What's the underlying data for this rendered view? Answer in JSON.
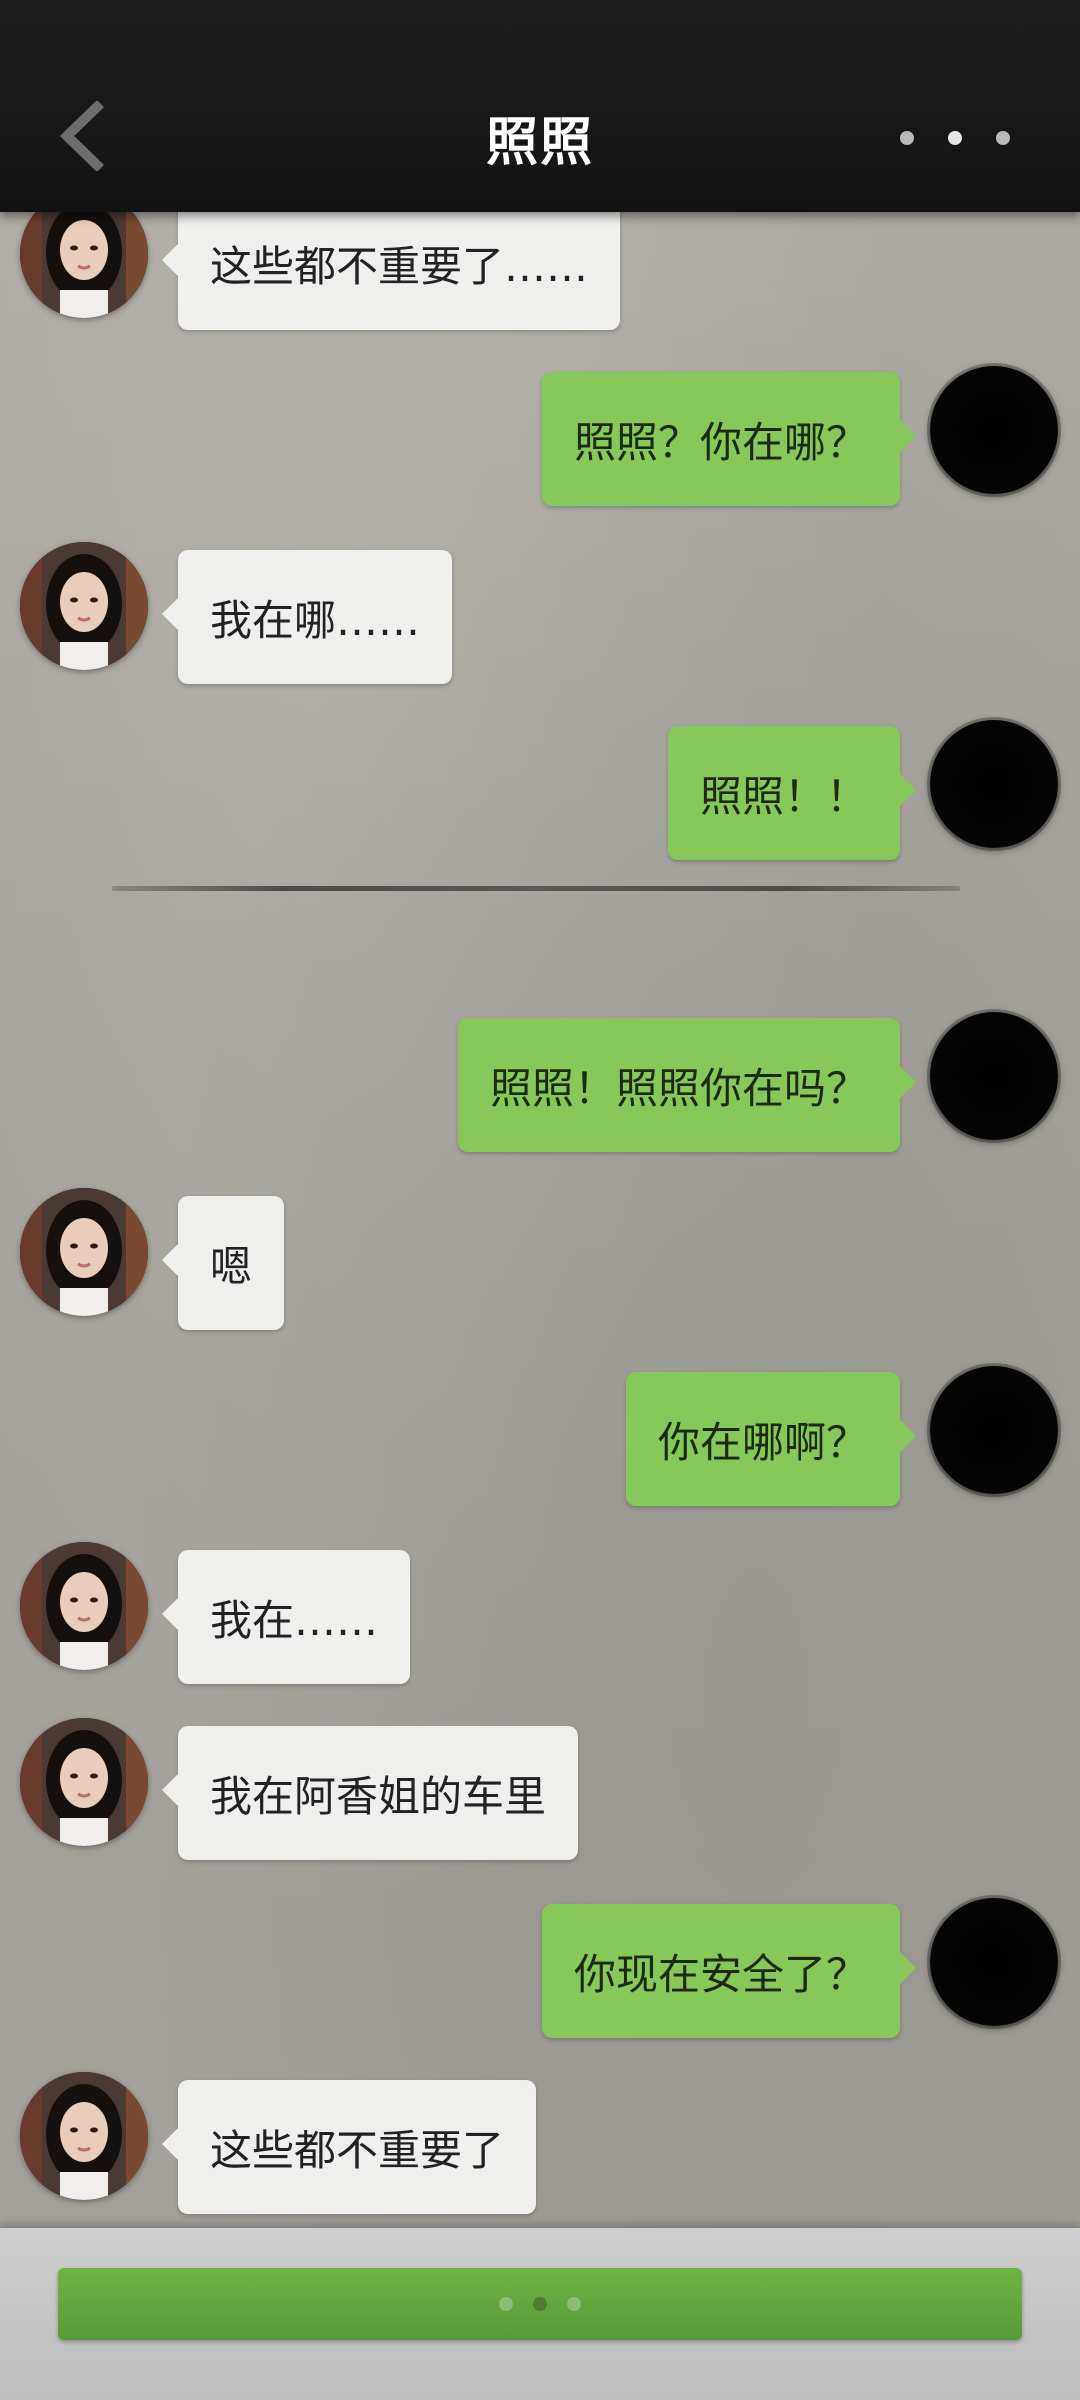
{
  "header": {
    "title": "照照"
  },
  "messages": [
    {
      "side": "left",
      "text": "这些都不重要了……"
    },
    {
      "side": "right",
      "text": "照照？你在哪？"
    },
    {
      "side": "left",
      "text": "我在哪……"
    },
    {
      "side": "right",
      "text": "照照！！"
    },
    {
      "side": "right",
      "text": "照照！照照你在吗？"
    },
    {
      "side": "left",
      "text": "嗯"
    },
    {
      "side": "right",
      "text": "你在哪啊？"
    },
    {
      "side": "left",
      "text": "我在……"
    },
    {
      "side": "left",
      "text": "我在阿香姐的车里"
    },
    {
      "side": "right",
      "text": "你现在安全了？"
    },
    {
      "side": "left",
      "text": "这些都不重要了"
    }
  ],
  "colors": {
    "header_bg": "#161616",
    "left_bubble": "#efefed",
    "right_bubble": "#86c85a",
    "bottom_button": "#62a63e"
  },
  "icons": {
    "back": "chevron-left-icon",
    "more": "more-dots-icon",
    "typing": "typing-dots-icon"
  }
}
